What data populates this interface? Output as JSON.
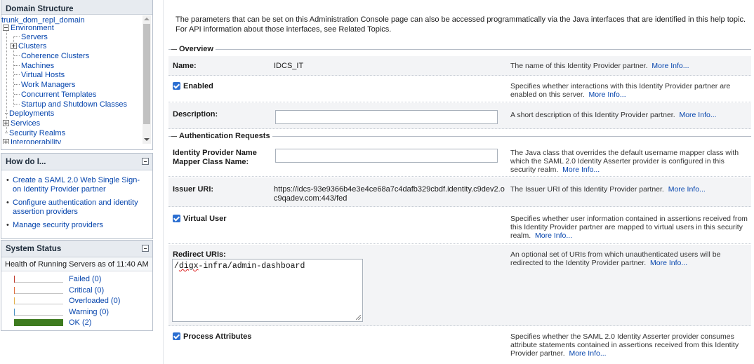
{
  "domain_structure": {
    "title": "Domain Structure",
    "tree": [
      {
        "label": "trunk_dom_repl_domain"
      },
      {
        "label": "Environment"
      },
      {
        "label": "Servers"
      },
      {
        "label": "Clusters"
      },
      {
        "label": "Coherence Clusters"
      },
      {
        "label": "Machines"
      },
      {
        "label": "Virtual Hosts"
      },
      {
        "label": "Work Managers"
      },
      {
        "label": "Concurrent Templates"
      },
      {
        "label": "Startup and Shutdown Classes"
      },
      {
        "label": "Deployments"
      },
      {
        "label": "Services"
      },
      {
        "label": "Security Realms"
      },
      {
        "label": "Interoperability"
      }
    ]
  },
  "how_do_i": {
    "title": "How do I...",
    "items": [
      {
        "label": "Create a SAML 2.0 Web Single Sign-on Identity Provider partner"
      },
      {
        "label": "Configure authentication and identity assertion providers"
      },
      {
        "label": "Manage security providers"
      }
    ]
  },
  "system_status": {
    "title": "System Status",
    "health_label": "Health of Running Servers as of  11:40 AM",
    "items": [
      {
        "label": "Failed (0)",
        "color": "#c0392b"
      },
      {
        "label": "Critical (0)",
        "color": "#e06c3c"
      },
      {
        "label": "Overloaded (0)",
        "color": "#e3b04b"
      },
      {
        "label": "Warning (0)",
        "color": "#4a90c2"
      },
      {
        "label": "OK (2)",
        "color": "#3e7b1f"
      }
    ]
  },
  "main": {
    "intro": "The parameters that can be set on this Administration Console page can also be accessed programmatically via the Java interfaces that are identified in this help topic. For API information about those interfaces, see Related Topics.",
    "overview": {
      "title": "Overview",
      "name": {
        "label": "Name:",
        "value": "IDCS_IT",
        "help": "The name of this Identity Provider partner.",
        "more": "More Info..."
      },
      "enabled": {
        "label": "Enabled",
        "help": "Specifies whether interactions with this Identity Provider partner are enabled on this server.",
        "more": "More Info..."
      },
      "description": {
        "label": "Description:",
        "value": "",
        "help": "A short description of this Identity Provider partner.",
        "more": "More Info..."
      }
    },
    "auth": {
      "title": "Authentication Requests",
      "mapper": {
        "label": "Identity Provider Name Mapper Class Name:",
        "value": "",
        "help": "The Java class that overrides the default username mapper class with which the SAML 2.0 Identity Asserter provider is configured in this security realm.",
        "more": "More Info..."
      },
      "issuer": {
        "label": "Issuer URI:",
        "value": "https://idcs-93e9366b4e3e4ce68a7c4dafb329cbdf.identity.c9dev2.oc9qadev.com:443/fed",
        "help": "The Issuer URI of this Identity Provider partner.",
        "more": "More Info..."
      },
      "virtual_user": {
        "label": "Virtual User",
        "help": "Specifies whether user information contained in assertions received from this Identity Provider partner are mapped to virtual users in this security realm.",
        "more": "More Info..."
      },
      "redirect": {
        "label": "Redirect URIs:",
        "value_prefix": "/",
        "value_spell": "digx",
        "value_rest": "-infra/admin-dashboard",
        "help": "An optional set of URIs from which unauthenticated users will be redirected to the Identity Provider partner.",
        "more": "More Info..."
      },
      "process_attrs": {
        "label": "Process Attributes",
        "help": "Specifies whether the SAML 2.0 Identity Asserter provider consumes attribute statements contained in assertions received from this Identity Provider partner.",
        "more": "More Info..."
      }
    }
  }
}
